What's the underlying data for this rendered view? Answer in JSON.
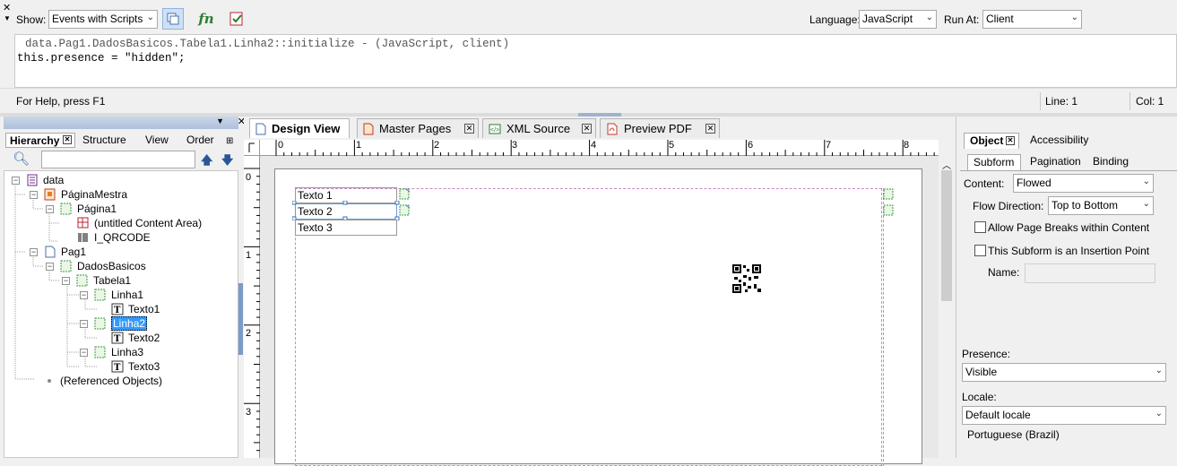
{
  "toolbar": {
    "show_label": "Show:",
    "show_value": "Events with Scripts",
    "language_label": "Language:",
    "language_value": "JavaScript",
    "runat_label": "Run At:",
    "runat_value": "Client"
  },
  "script": {
    "header": "data.Pag1.DadosBasicos.Tabela1.Linha2::initialize - (JavaScript, client)",
    "code": "this.presence = \"hidden\";"
  },
  "status": {
    "help": "For Help, press F1",
    "line": "Line: 1",
    "col": "Col: 1"
  },
  "hierarchy": {
    "tabs": [
      "Hierarchy",
      "Structure",
      "View",
      "Order"
    ],
    "search_placeholder": "",
    "nodes": [
      {
        "label": "data"
      },
      {
        "label": "PáginaMestra"
      },
      {
        "label": "Página1"
      },
      {
        "label": "(untitled Content Area)"
      },
      {
        "label": "I_QRCODE"
      },
      {
        "label": "Pag1"
      },
      {
        "label": "DadosBasicos"
      },
      {
        "label": "Tabela1"
      },
      {
        "label": "Linha1"
      },
      {
        "label": "Texto1"
      },
      {
        "label": "Linha2"
      },
      {
        "label": "Texto2"
      },
      {
        "label": "Linha3"
      },
      {
        "label": "Texto3"
      },
      {
        "label": "(Referenced Objects)"
      }
    ]
  },
  "design": {
    "tabs": [
      "Design View",
      "Master Pages",
      "XML Source",
      "Preview PDF"
    ],
    "ruler_h": [
      "0",
      "1",
      "2",
      "3",
      "4",
      "5",
      "6",
      "7",
      "8"
    ],
    "ruler_v": [
      "0",
      "1",
      "2",
      "3"
    ],
    "fields": [
      "Texto 1",
      "Texto 2",
      "Texto 3"
    ]
  },
  "object": {
    "tabs": [
      "Object",
      "Accessibility"
    ],
    "subtabs": [
      "Subform",
      "Pagination",
      "Binding"
    ],
    "content_label": "Content:",
    "content_value": "Flowed",
    "flow_label": "Flow Direction:",
    "flow_value": "Top to Bottom",
    "allow_breaks": "Allow Page Breaks within Content",
    "insertion_point": "This Subform is an Insertion Point",
    "name_label": "Name:",
    "presence_label": "Presence:",
    "presence_value": "Visible",
    "locale_label": "Locale:",
    "locale_value": "Default locale",
    "locale_note": "Portuguese (Brazil)"
  }
}
